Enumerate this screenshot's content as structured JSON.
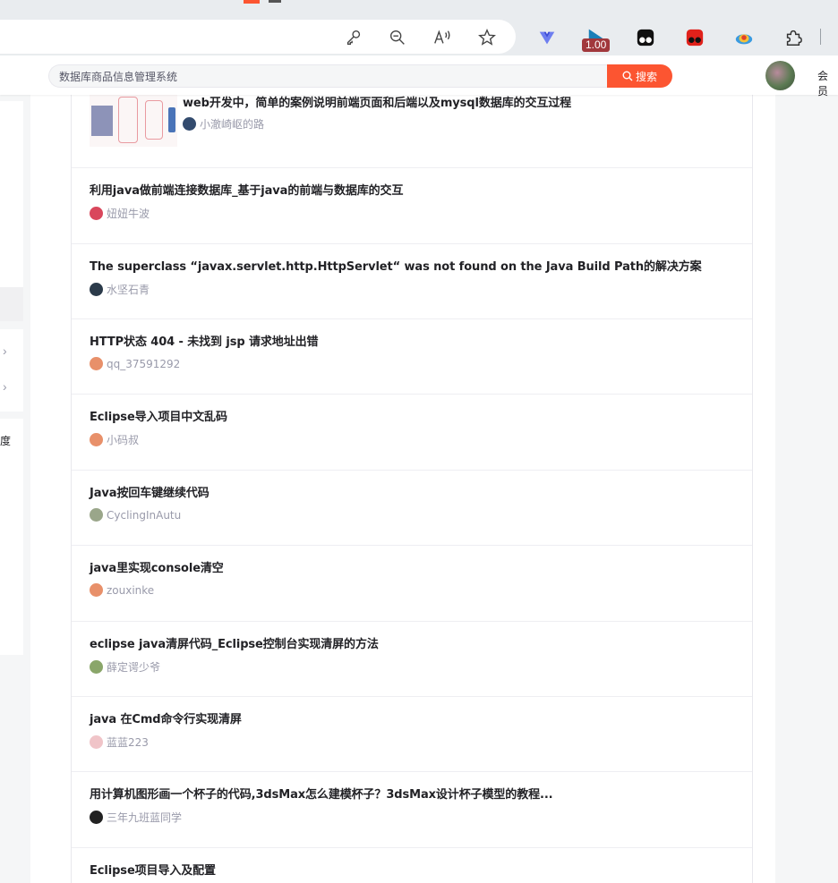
{
  "browser": {
    "zoom_badge": "1.00",
    "toolbar_icons": [
      "key-icon",
      "zoom-out-icon",
      "read-aloud-icon",
      "favorite-star-icon",
      "extension-vue-icon",
      "extension-graph-icon",
      "extension-tampermonkey-icon",
      "extension-red-icon",
      "extension-colorful-icon",
      "extensions-puzzle-icon"
    ]
  },
  "header": {
    "search_placeholder": "数据库商品信息管理系统",
    "search_button_label": "搜索",
    "vip_label": "会员",
    "accent_color": "#fc5531"
  },
  "sidebar": {
    "fragment_text": "度"
  },
  "articles": [
    {
      "title": "web开发中，简单的案例说明前端页面和后端以及mysql数据库的交互过程",
      "author": "小澈崎岖的路",
      "has_thumbnail": true,
      "avatar_color": "#334b6e"
    },
    {
      "title": "利用java做前端连接数据库_基于java的前端与数据库的交互",
      "author": "妞妞牛波",
      "has_thumbnail": false,
      "avatar_color": "#d9475c"
    },
    {
      "title": "The superclass “javax.servlet.http.HttpServlet“ was not found on the Java Build Path的解决方案",
      "author": "水坚石青",
      "has_thumbnail": false,
      "avatar_color": "#2b3a4a"
    },
    {
      "title": "HTTP状态 404 - 未找到 jsp 请求地址出错",
      "author": "qq_37591292",
      "has_thumbnail": false,
      "avatar_color": "#e8906a"
    },
    {
      "title": "Eclipse导入项目中文乱码",
      "author": "小码叔",
      "has_thumbnail": false,
      "avatar_color": "#e8906a"
    },
    {
      "title": "Java按回车键继续代码",
      "author": "CyclingInAutu",
      "has_thumbnail": false,
      "avatar_color": "#9aa68a"
    },
    {
      "title": "java里实现console清空",
      "author": "zouxinke",
      "has_thumbnail": false,
      "avatar_color": "#e8906a"
    },
    {
      "title": "eclipse java清屏代码_Eclipse控制台实现清屏的方法",
      "author": "薛定谔少爷",
      "has_thumbnail": false,
      "avatar_color": "#8aa66a"
    },
    {
      "title": "java 在Cmd命令行实现清屏",
      "author": "蓝蓝223",
      "has_thumbnail": false,
      "avatar_color": "#f0c4c8"
    },
    {
      "title": "用计算机图形画一个杯子的代码,3dsMax怎么建模杯子？3dsMax设计杯子模型的教程...",
      "author": "三年九班蓝同学",
      "has_thumbnail": false,
      "avatar_color": "#222222"
    },
    {
      "title": "Eclipse项目导入及配置",
      "author": "",
      "has_thumbnail": false,
      "avatar_color": "#cccccc"
    }
  ]
}
